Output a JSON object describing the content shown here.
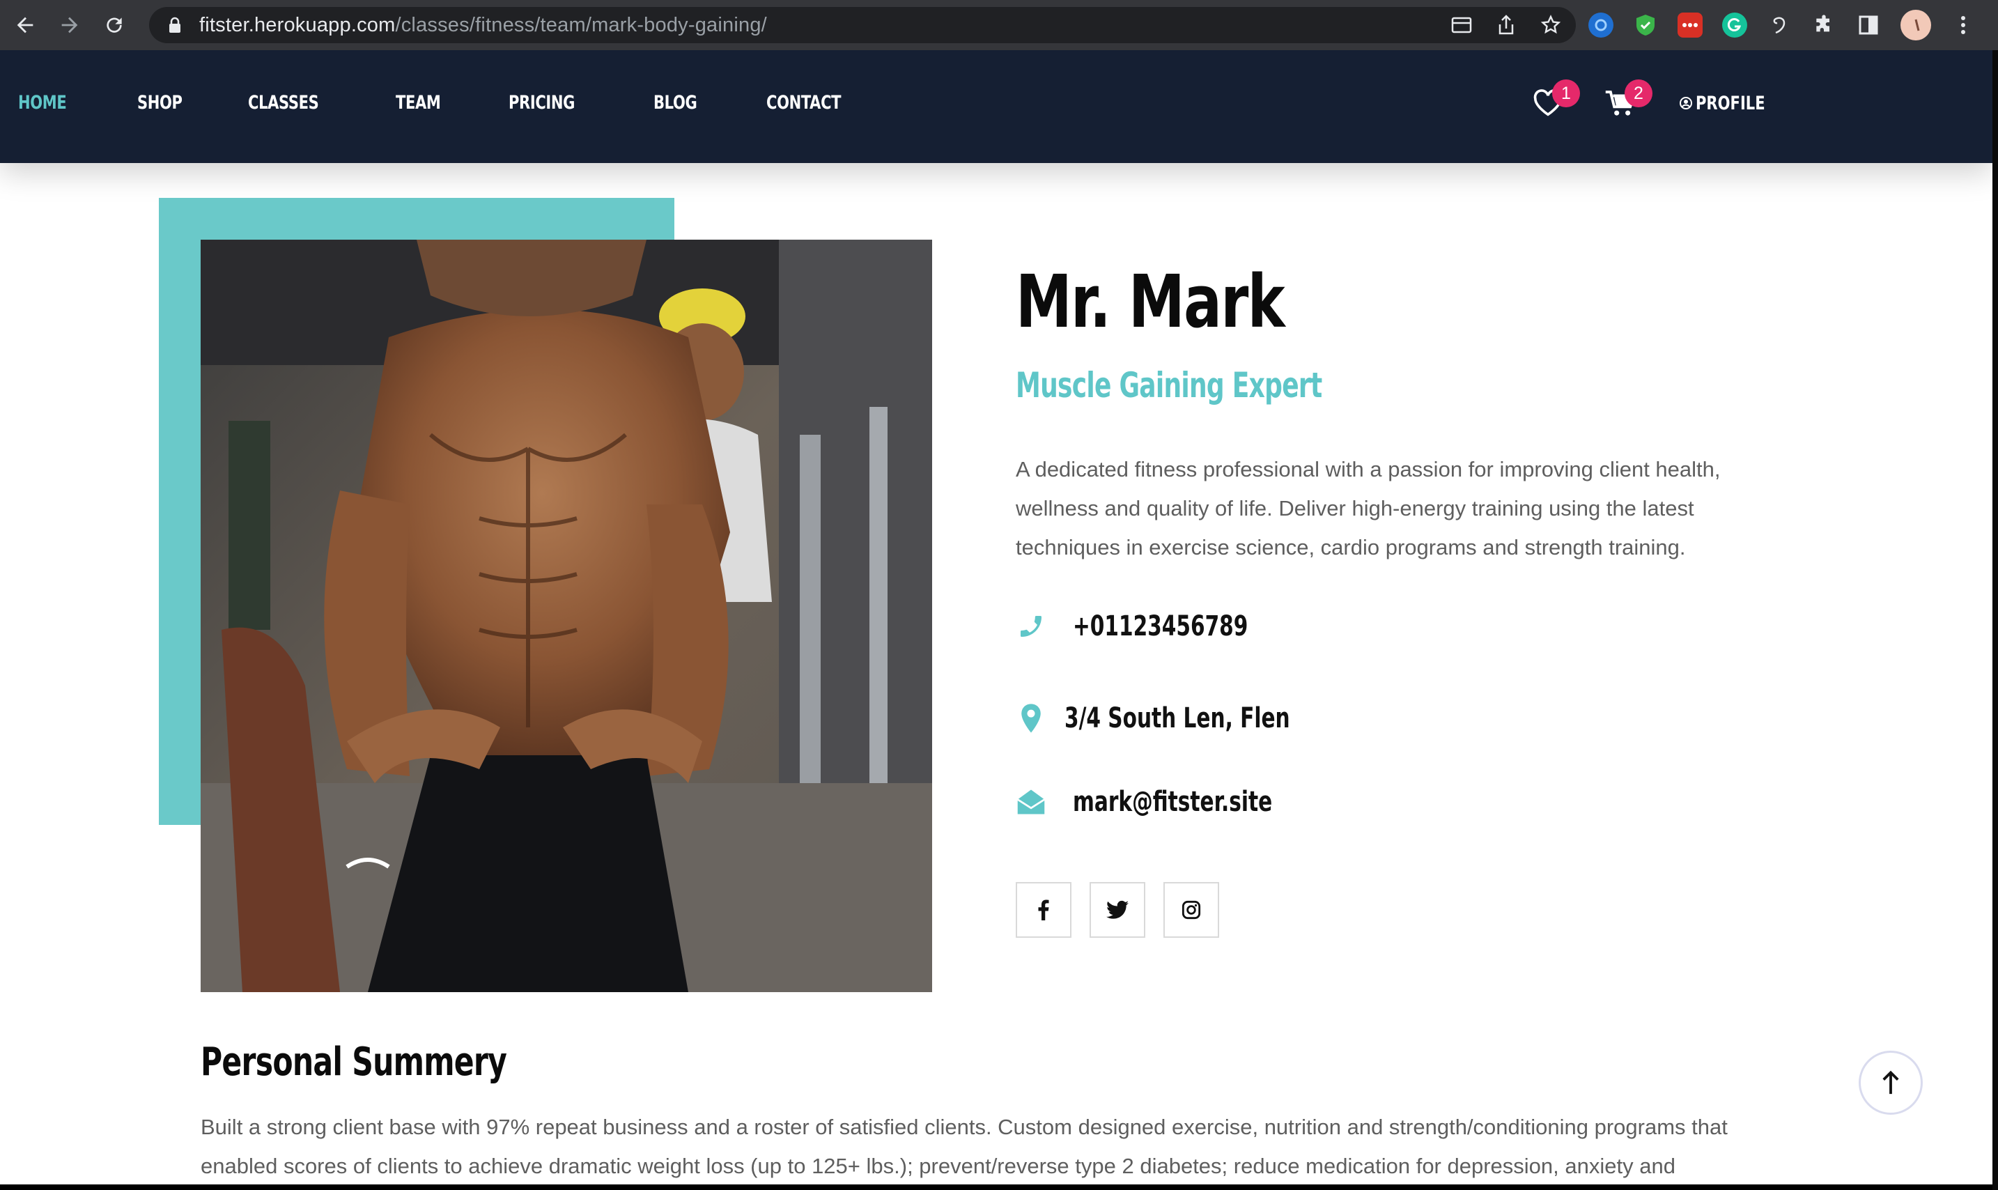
{
  "browser": {
    "url_host": "fitster.herokuapp.com",
    "url_path": "/classes/fitness/team/mark-body-gaining/",
    "icons": [
      "back-icon",
      "forward-icon",
      "reload-icon",
      "lock-icon",
      "tab-search-icon",
      "share-icon",
      "bookmark-star-icon",
      "extensions-icon",
      "side-panel-icon",
      "menu-icon"
    ]
  },
  "header": {
    "menu": [
      {
        "label": "HOME",
        "active": true
      },
      {
        "label": "SHOP",
        "active": false
      },
      {
        "label": "CLASSES",
        "active": false
      },
      {
        "label": "TEAM",
        "active": false
      },
      {
        "label": "PRICING",
        "active": false
      },
      {
        "label": "BLOG",
        "active": false
      },
      {
        "label": "CONTACT",
        "active": false
      }
    ],
    "wishlist_count": "1",
    "cart_count": "2",
    "profile_label": "PROFILE"
  },
  "trainer": {
    "name": "Mr. Mark",
    "role": "Muscle Gaining Expert",
    "bio": "A dedicated fitness professional with a passion for improving client health, wellness and quality of life. Deliver high-energy training using the latest techniques in exercise science, cardio programs and strength training.",
    "phone": "+01123456789",
    "address": "3/4 South Len, Flen",
    "email": "mark@fitster.site",
    "socials": [
      "facebook-icon",
      "twitter-icon",
      "instagram-icon"
    ]
  },
  "summary": {
    "title": "Personal Summery",
    "text": "Built a strong client base with 97% repeat business and a roster of satisfied clients. Custom designed exercise, nutrition and strength/conditioning programs that enabled scores of clients to achieve dramatic weight loss (up to 125+ lbs.); prevent/reverse type 2 diabetes; reduce medication for depression, anxiety and"
  },
  "colors": {
    "header_bg": "#151f33",
    "accent": "#5fc6c8",
    "badge": "#e5296a"
  }
}
